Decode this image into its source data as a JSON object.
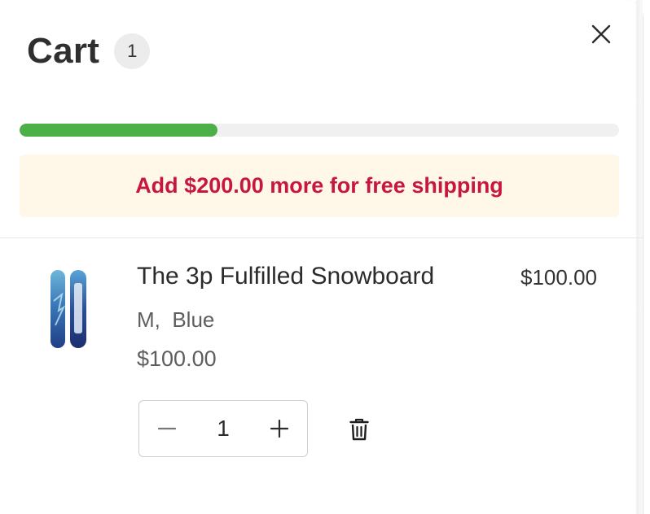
{
  "cart": {
    "title": "Cart",
    "item_count": "1",
    "free_shipping_progress": 0.33,
    "free_shipping_message": "Add $200.00 more for free shipping"
  },
  "items": [
    {
      "name": "The 3p Fulfilled Snowboard",
      "variant": "M,  Blue",
      "unit_price": "$100.00",
      "line_total": "$100.00",
      "quantity": "1"
    }
  ],
  "icons": {
    "close": "close-icon",
    "minus": "minus-icon",
    "plus": "plus-icon",
    "delete": "trash-icon",
    "thumbnail": "snowboard-image"
  },
  "colors": {
    "progress_fill": "#4caf48",
    "progress_track": "#f0f0f0",
    "banner_bg": "#fff8e9",
    "banner_text": "#c8173f"
  }
}
